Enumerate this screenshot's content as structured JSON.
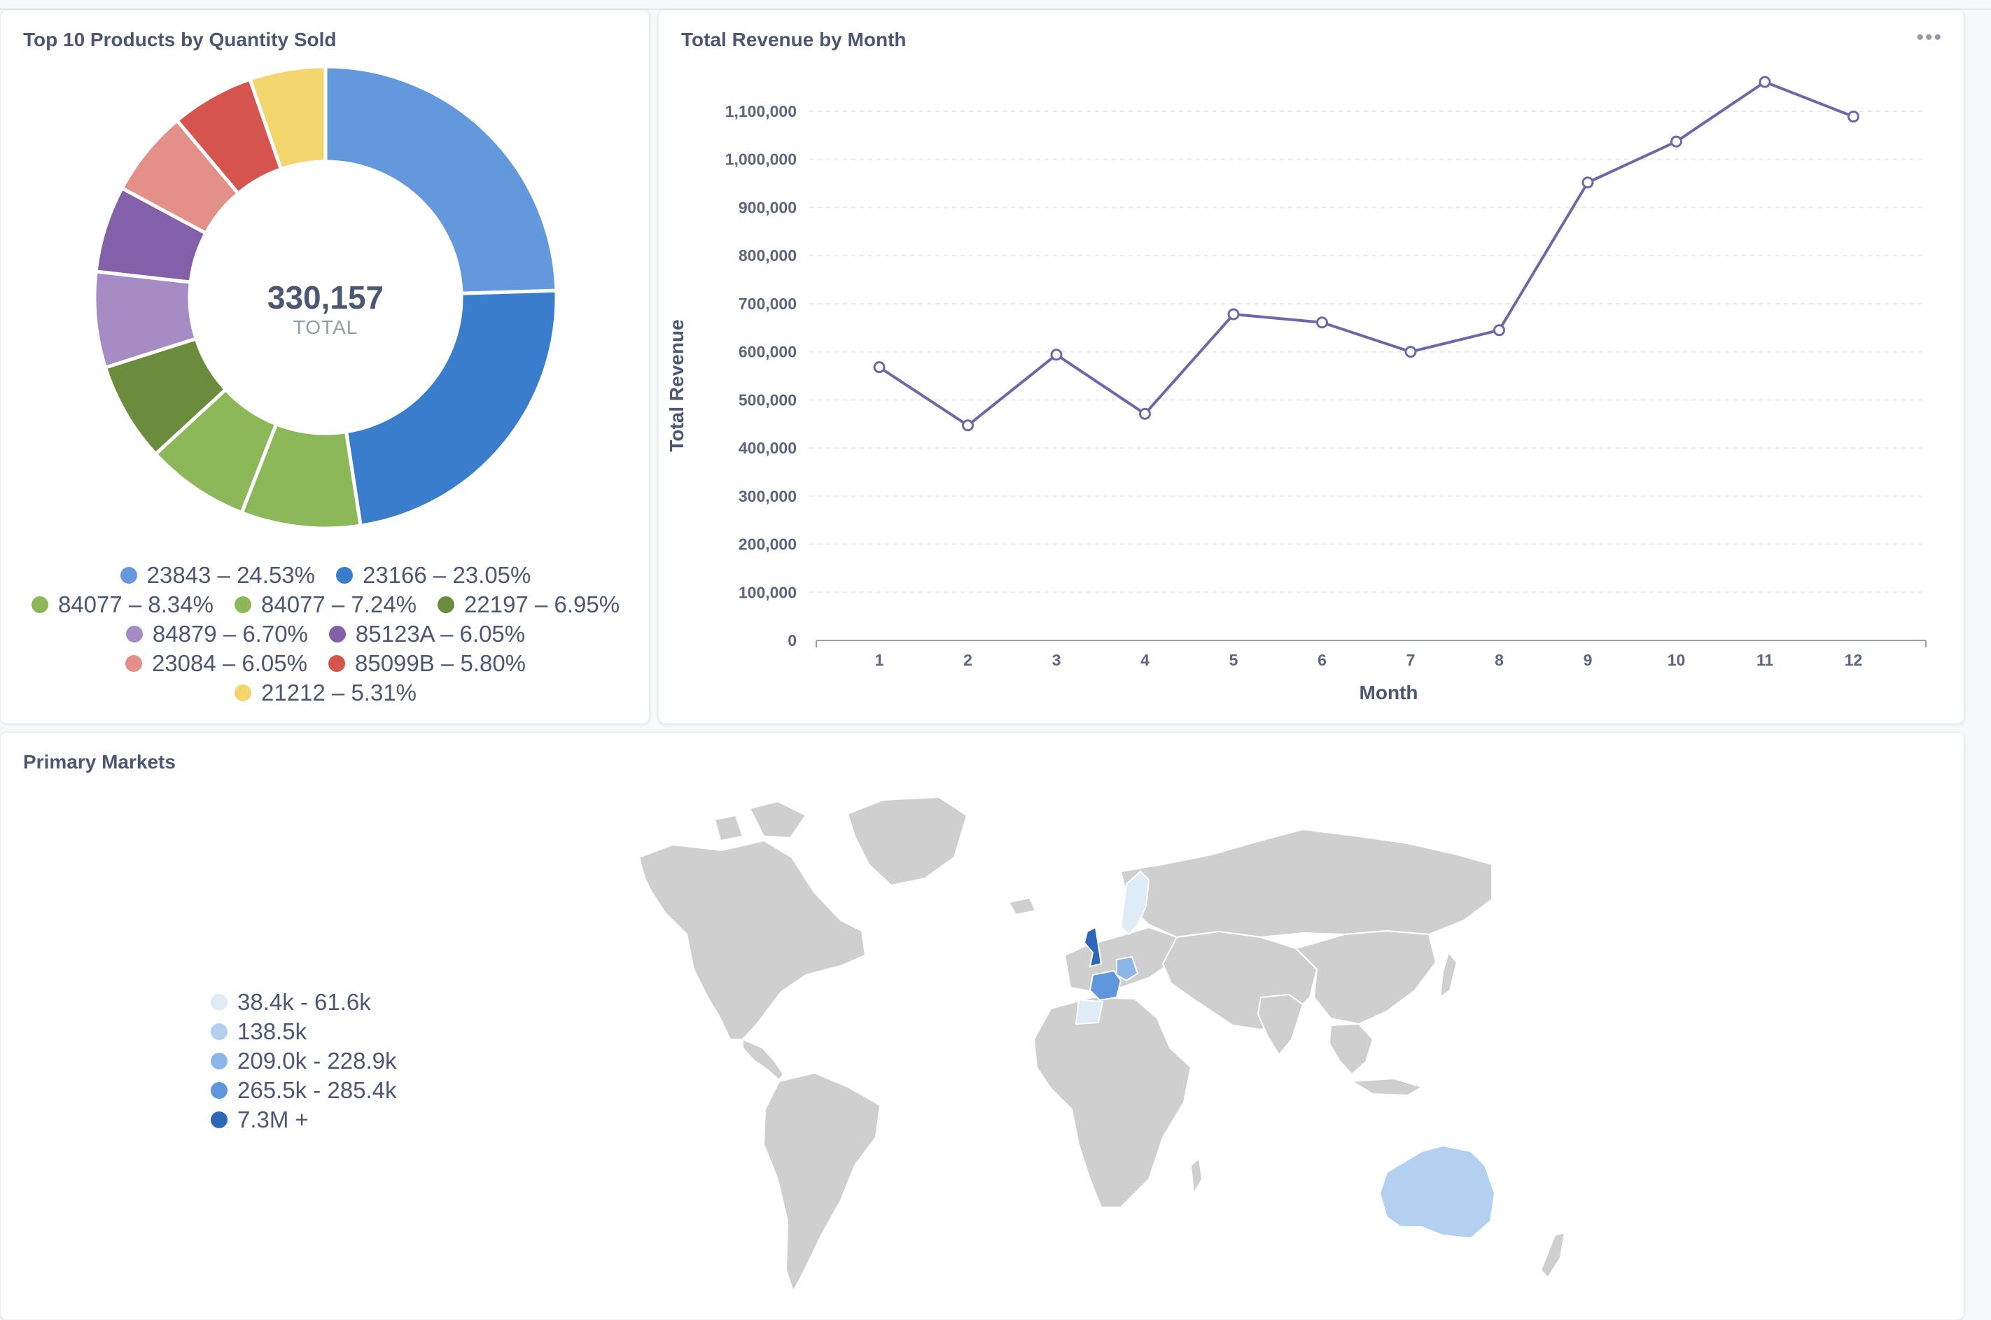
{
  "donut": {
    "title": "Top 10 Products by Quantity Sold",
    "center_value": "330,157",
    "center_label": "TOTAL",
    "legend_rows": [
      [
        {
          "label": "23843 – 24.53%",
          "color": "#6399dc"
        },
        {
          "label": "23166 – 23.05%",
          "color": "#3b7dcd"
        }
      ],
      [
        {
          "label": "84077 – 8.34%",
          "color": "#8cb85a"
        },
        {
          "label": "84077 – 7.24%",
          "color": "#8cb85a"
        },
        {
          "label": "22197 – 6.95%",
          "color": "#6a8c3c"
        }
      ],
      [
        {
          "label": "84879 – 6.70%",
          "color": "#a68bc4"
        },
        {
          "label": "85123A – 6.05%",
          "color": "#8460aa"
        }
      ],
      [
        {
          "label": "23084 – 6.05%",
          "color": "#e39089"
        },
        {
          "label": "85099B – 5.80%",
          "color": "#d6544e"
        }
      ],
      [
        {
          "label": "21212 – 5.31%",
          "color": "#f3d56e"
        }
      ]
    ]
  },
  "line": {
    "title": "Total Revenue by Month",
    "more_label": "•••"
  },
  "map": {
    "title": "Primary Markets",
    "legend": [
      {
        "label": "38.4k - 61.6k",
        "color": "#e0ebf8"
      },
      {
        "label": "138.5k",
        "color": "#b4d0f1"
      },
      {
        "label": "209.0k - 228.9k",
        "color": "#8db6e8"
      },
      {
        "label": "265.5k - 285.4k",
        "color": "#5f96dc"
      },
      {
        "label": "7.3M +",
        "color": "#2f67b8"
      }
    ],
    "country_color_default": "#cfcfcf"
  },
  "chart_data": [
    {
      "type": "pie",
      "title": "Top 10 Products by Quantity Sold",
      "total": 330157,
      "categories": [
        "23843",
        "23166",
        "84077",
        "84077",
        "22197",
        "84879",
        "85123A",
        "23084",
        "85099B",
        "21212"
      ],
      "values": [
        24.53,
        23.05,
        8.34,
        7.24,
        6.95,
        6.7,
        6.05,
        6.05,
        5.8,
        5.31
      ],
      "colors": [
        "#6399dc",
        "#3b7dcd",
        "#8cb85a",
        "#8cb85a",
        "#6a8c3c",
        "#a68bc4",
        "#8460aa",
        "#e39089",
        "#d6544e",
        "#f3d56e"
      ]
    },
    {
      "type": "line",
      "title": "Total Revenue by Month",
      "xlabel": "Month",
      "ylabel": "Total Revenue",
      "x": [
        1,
        2,
        3,
        4,
        5,
        6,
        7,
        8,
        9,
        10,
        11,
        12
      ],
      "series": [
        {
          "values": [
            568000,
            447000,
            594000,
            471000,
            678000,
            661000,
            600000,
            645000,
            952000,
            1037000,
            1161000,
            1089000
          ],
          "color": "#6b69a8"
        }
      ],
      "ylim": [
        0,
        1100000
      ],
      "yticks": [
        0,
        100000,
        200000,
        300000,
        400000,
        500000,
        600000,
        700000,
        800000,
        900000,
        1000000,
        1100000
      ],
      "ytick_labels": [
        "0",
        "100,000",
        "200,000",
        "300,000",
        "400,000",
        "500,000",
        "600,000",
        "700,000",
        "800,000",
        "900,000",
        "1,000,000",
        "1,100,000"
      ],
      "grid": true
    }
  ]
}
